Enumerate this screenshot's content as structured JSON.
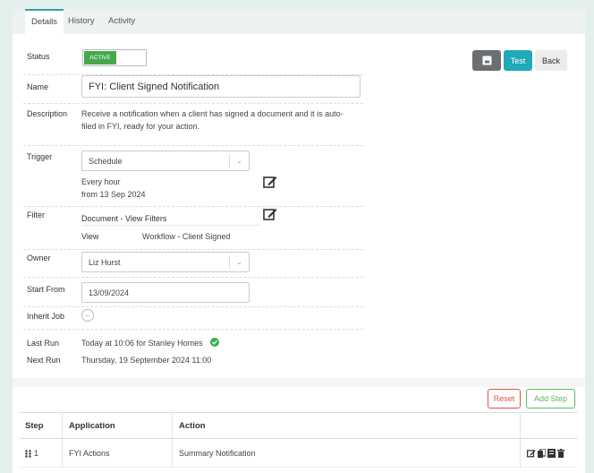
{
  "tabs": [
    "Details",
    "History",
    "Activity"
  ],
  "labels": {
    "status": "Status",
    "name": "Name",
    "description": "Description",
    "trigger": "Trigger",
    "filter": "Filter",
    "owner": "Owner",
    "start_from": "Start From",
    "inherit_job": "Inherit Job",
    "last_run": "Last Run",
    "next_run": "Next Run"
  },
  "status_toggle": "ACTIVE",
  "name_value": "FYI: Client Signed Notification",
  "description": {
    "line1": "Receive a notification when a client has signed a document and it is auto-",
    "line2": "filed in FYI, ready for your action."
  },
  "trigger": {
    "value": "Schedule",
    "frequency": "Every hour",
    "from": "from 13 Sep 2024"
  },
  "filter": {
    "title": "Document - View Filters",
    "view_label": "View",
    "view_value": "Workflow - Client Signed"
  },
  "owner": "Liz Hurst",
  "start_from": "13/09/2024",
  "last_run": "Today at 10:06 for Stanley Homes",
  "next_run": "Thursday, 19 September 2024 11:00",
  "buttons": {
    "test": "Test",
    "back": "Back",
    "reset": "Reset",
    "add_step": "Add Step"
  },
  "table": {
    "headers": [
      "Step",
      "Application",
      "Action"
    ],
    "rows": [
      {
        "step": "1",
        "application": "FYI Actions",
        "action": "Summary Notification"
      }
    ]
  },
  "colors": {
    "accent": "#2aa79b",
    "active": "#46a84d",
    "test_button": "#1fa9b9",
    "reset": "#d9534f",
    "add_step": "#5cb85c"
  }
}
